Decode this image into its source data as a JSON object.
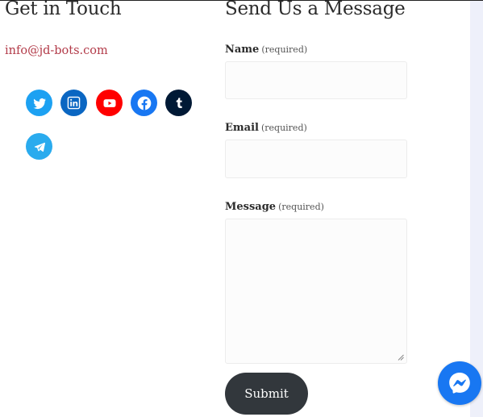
{
  "contact": {
    "heading": "Get in Touch",
    "email": "info@jd-bots.com",
    "social": [
      {
        "icon": "twitter-icon",
        "color": "#1da1f2"
      },
      {
        "icon": "linkedin-icon",
        "color": "#0a66c2"
      },
      {
        "icon": "youtube-icon",
        "color": "#ff0000"
      },
      {
        "icon": "facebook-icon",
        "color": "#1877f2"
      },
      {
        "icon": "tumblr-icon",
        "color": "#001935"
      },
      {
        "icon": "telegram-icon",
        "color": "#2aabee"
      }
    ]
  },
  "form": {
    "heading": "Send Us a Message",
    "name_label": "Name",
    "name_required": "(required)",
    "name_value": "",
    "email_label": "Email",
    "email_required": "(required)",
    "email_value": "",
    "message_label": "Message",
    "message_required": "(required)",
    "message_value": "",
    "submit_label": "Submit"
  },
  "chat_widget": {
    "icon": "messenger-icon",
    "color": "#1877f2"
  },
  "colors": {
    "link": "#b23a48",
    "button": "#32373c",
    "text": "#2b2b2b"
  }
}
